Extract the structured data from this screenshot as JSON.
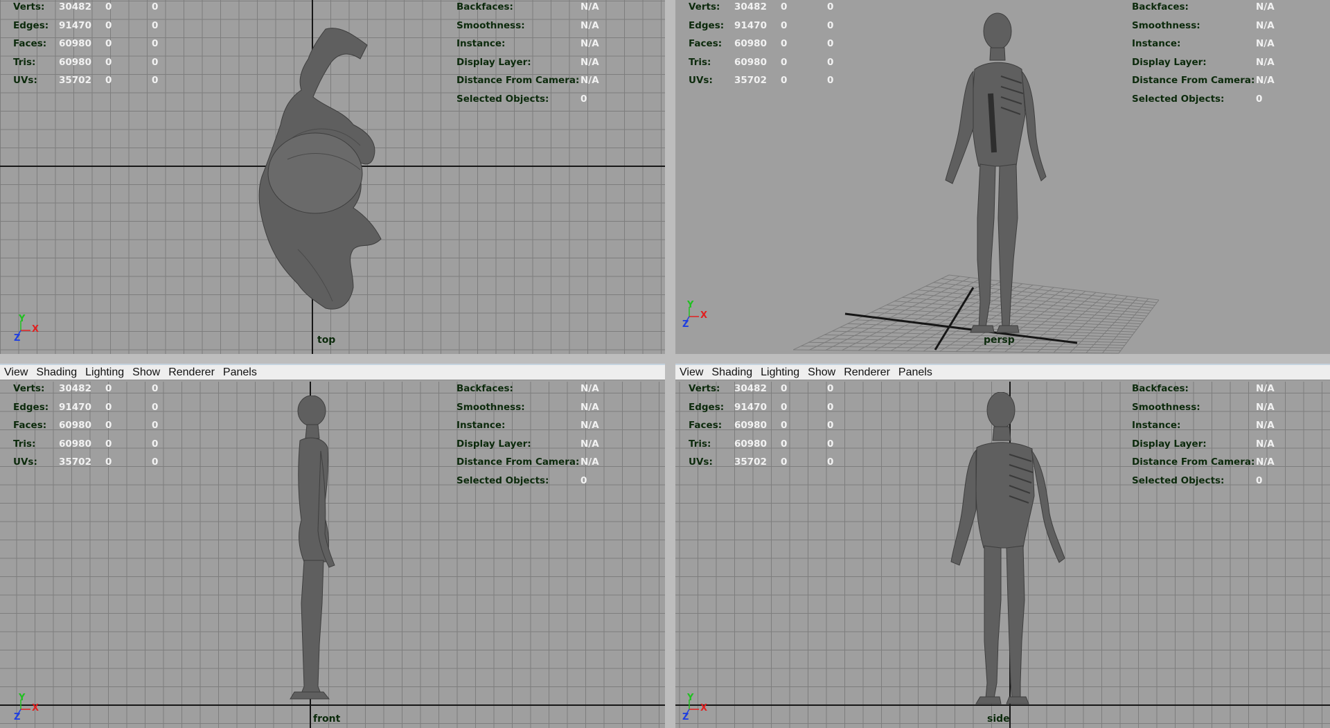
{
  "menu": [
    "View",
    "Shading",
    "Lighting",
    "Show",
    "Renderer",
    "Panels"
  ],
  "hud_left": [
    {
      "label": "Verts:",
      "v1": "30482",
      "v2": "0",
      "v3": "0"
    },
    {
      "label": "Edges:",
      "v1": "91470",
      "v2": "0",
      "v3": "0"
    },
    {
      "label": "Faces:",
      "v1": "60980",
      "v2": "0",
      "v3": "0"
    },
    {
      "label": "Tris:",
      "v1": "60980",
      "v2": "0",
      "v3": "0"
    },
    {
      "label": "UVs:",
      "v1": "35702",
      "v2": "0",
      "v3": "0"
    }
  ],
  "hud_right": [
    {
      "label": "Backfaces:",
      "value": "N/A"
    },
    {
      "label": "Smoothness:",
      "value": "N/A"
    },
    {
      "label": "Instance:",
      "value": "N/A"
    },
    {
      "label": "Display Layer:",
      "value": "N/A"
    },
    {
      "label": "Distance From Camera:",
      "value": "N/A"
    },
    {
      "label": "Selected Objects:",
      "value": "0"
    }
  ],
  "viewports": {
    "top": {
      "camera": "top",
      "axis": {
        "upper": "Y",
        "right": "X",
        "lower": "Z"
      }
    },
    "persp": {
      "camera": "persp",
      "axis": {
        "upper": "Y",
        "right": "X",
        "lower": "Z"
      }
    },
    "front": {
      "camera": "front",
      "axis": {
        "upper": "Y",
        "right": "X",
        "lower": "Z"
      }
    },
    "side": {
      "camera": "side",
      "axis": {
        "upper": "Y",
        "right": "X",
        "lower": "Z"
      }
    }
  },
  "colors": {
    "viewport_bg": "#9f9f9f",
    "grid_line": "#7d7d7d",
    "axis_line": "#161616",
    "model": "#5f5f5f",
    "hud_label": "#0c2a0c",
    "hud_value": "#f2f2f2",
    "axis_x": "#e02020",
    "axis_y": "#20c020",
    "axis_z": "#2040e0"
  }
}
